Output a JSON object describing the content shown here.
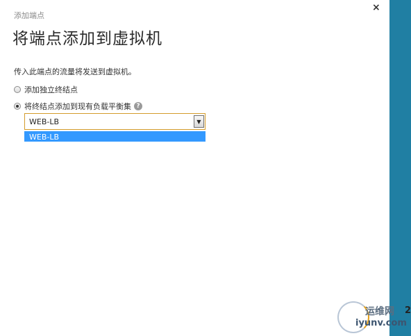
{
  "dialog": {
    "breadcrumb": "添加端点",
    "title": "将端点添加到虚拟机",
    "close_glyph": "×",
    "description": "传入此端点的流量将发送到虚拟机。",
    "options": [
      {
        "label": "添加独立终结点",
        "selected": false
      },
      {
        "label": "将终结点添加到现有负载平衡集",
        "selected": true
      }
    ],
    "help_glyph": "?",
    "load_balancer_select": {
      "value": "WEB-LB",
      "arrow_glyph": "▼",
      "dropdown_options": [
        "WEB-LB"
      ]
    }
  },
  "sidebar": {
    "color": "#207fa3"
  },
  "watermark": {
    "line1": "运维网",
    "line2": "iyunv.com",
    "digit": "2"
  },
  "colors": {
    "accent": "#207fa3",
    "dropdown_highlight": "#3399ff",
    "select_border": "#d39b2a"
  }
}
